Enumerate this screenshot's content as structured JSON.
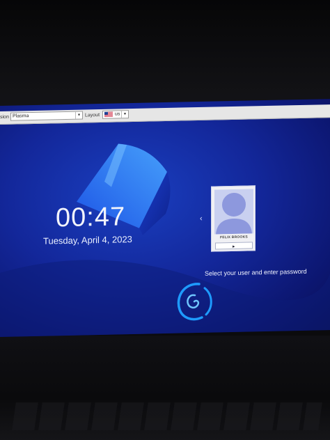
{
  "topbar": {
    "session_label": "sion",
    "session_value": "Plasma",
    "layout_label": "Layout",
    "layout_value": "us"
  },
  "clock": {
    "time": "00:47",
    "date": "Tuesday, April 4, 2023"
  },
  "login": {
    "prev_user_glyph": "‹",
    "user_name": "FELIX BROOKS",
    "password_value": "",
    "prompt": "Select your user and enter password"
  },
  "colors": {
    "wallpaper_primary": "#13279a",
    "wallpaper_accent": "#2f7bff",
    "logo": "#1e9bff"
  },
  "icons": {
    "flag": "us-flag-icon",
    "avatar": "user-avatar-icon",
    "logo": "debian-swirl-icon"
  }
}
